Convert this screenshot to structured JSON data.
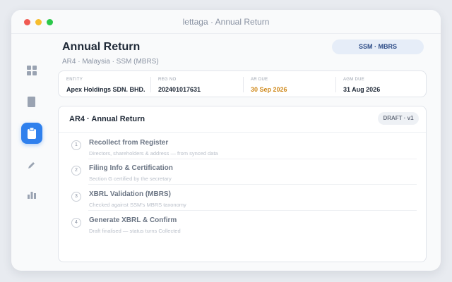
{
  "window": {
    "title": "lettaga · Annual Return"
  },
  "sidebar": {
    "items": [
      {
        "icon": "grid-icon"
      },
      {
        "icon": "document-icon"
      },
      {
        "icon": "clipboard-icon",
        "active": true
      },
      {
        "icon": "pen-icon"
      },
      {
        "icon": "bar-chart-icon"
      }
    ]
  },
  "header": {
    "title": "Annual Return",
    "subtitle": "AR4 · Malaysia · SSM (MBRS)",
    "badge": "SSM · MBRS"
  },
  "info": {
    "fields": [
      {
        "label": "ENTITY",
        "value": "Apex Holdings SDN. BHD."
      },
      {
        "label": "REG NO",
        "value": "202401017631"
      },
      {
        "label": "AR DUE",
        "value": "30 Sep 2026"
      },
      {
        "label": "AGM DUE",
        "value": "31 Aug 2026"
      }
    ]
  },
  "card": {
    "title": "AR4 · Annual Return",
    "badge": "DRAFT · v1",
    "steps": [
      {
        "num": "1",
        "title": "Recollect from Register",
        "desc": "Directors, shareholders & address — from synced data"
      },
      {
        "num": "2",
        "title": "Filing Info & Certification",
        "desc": "Section G certified by the secretary"
      },
      {
        "num": "3",
        "title": "XBRL Validation (MBRS)",
        "desc": "Checked against SSM's MBRS taxonomy"
      },
      {
        "num": "4",
        "title": "Generate XBRL & Confirm",
        "desc": "Draft finalised — status turns Collected"
      }
    ]
  },
  "colors": {
    "accent": "#2f80ed",
    "warning": "#d08a1d"
  }
}
